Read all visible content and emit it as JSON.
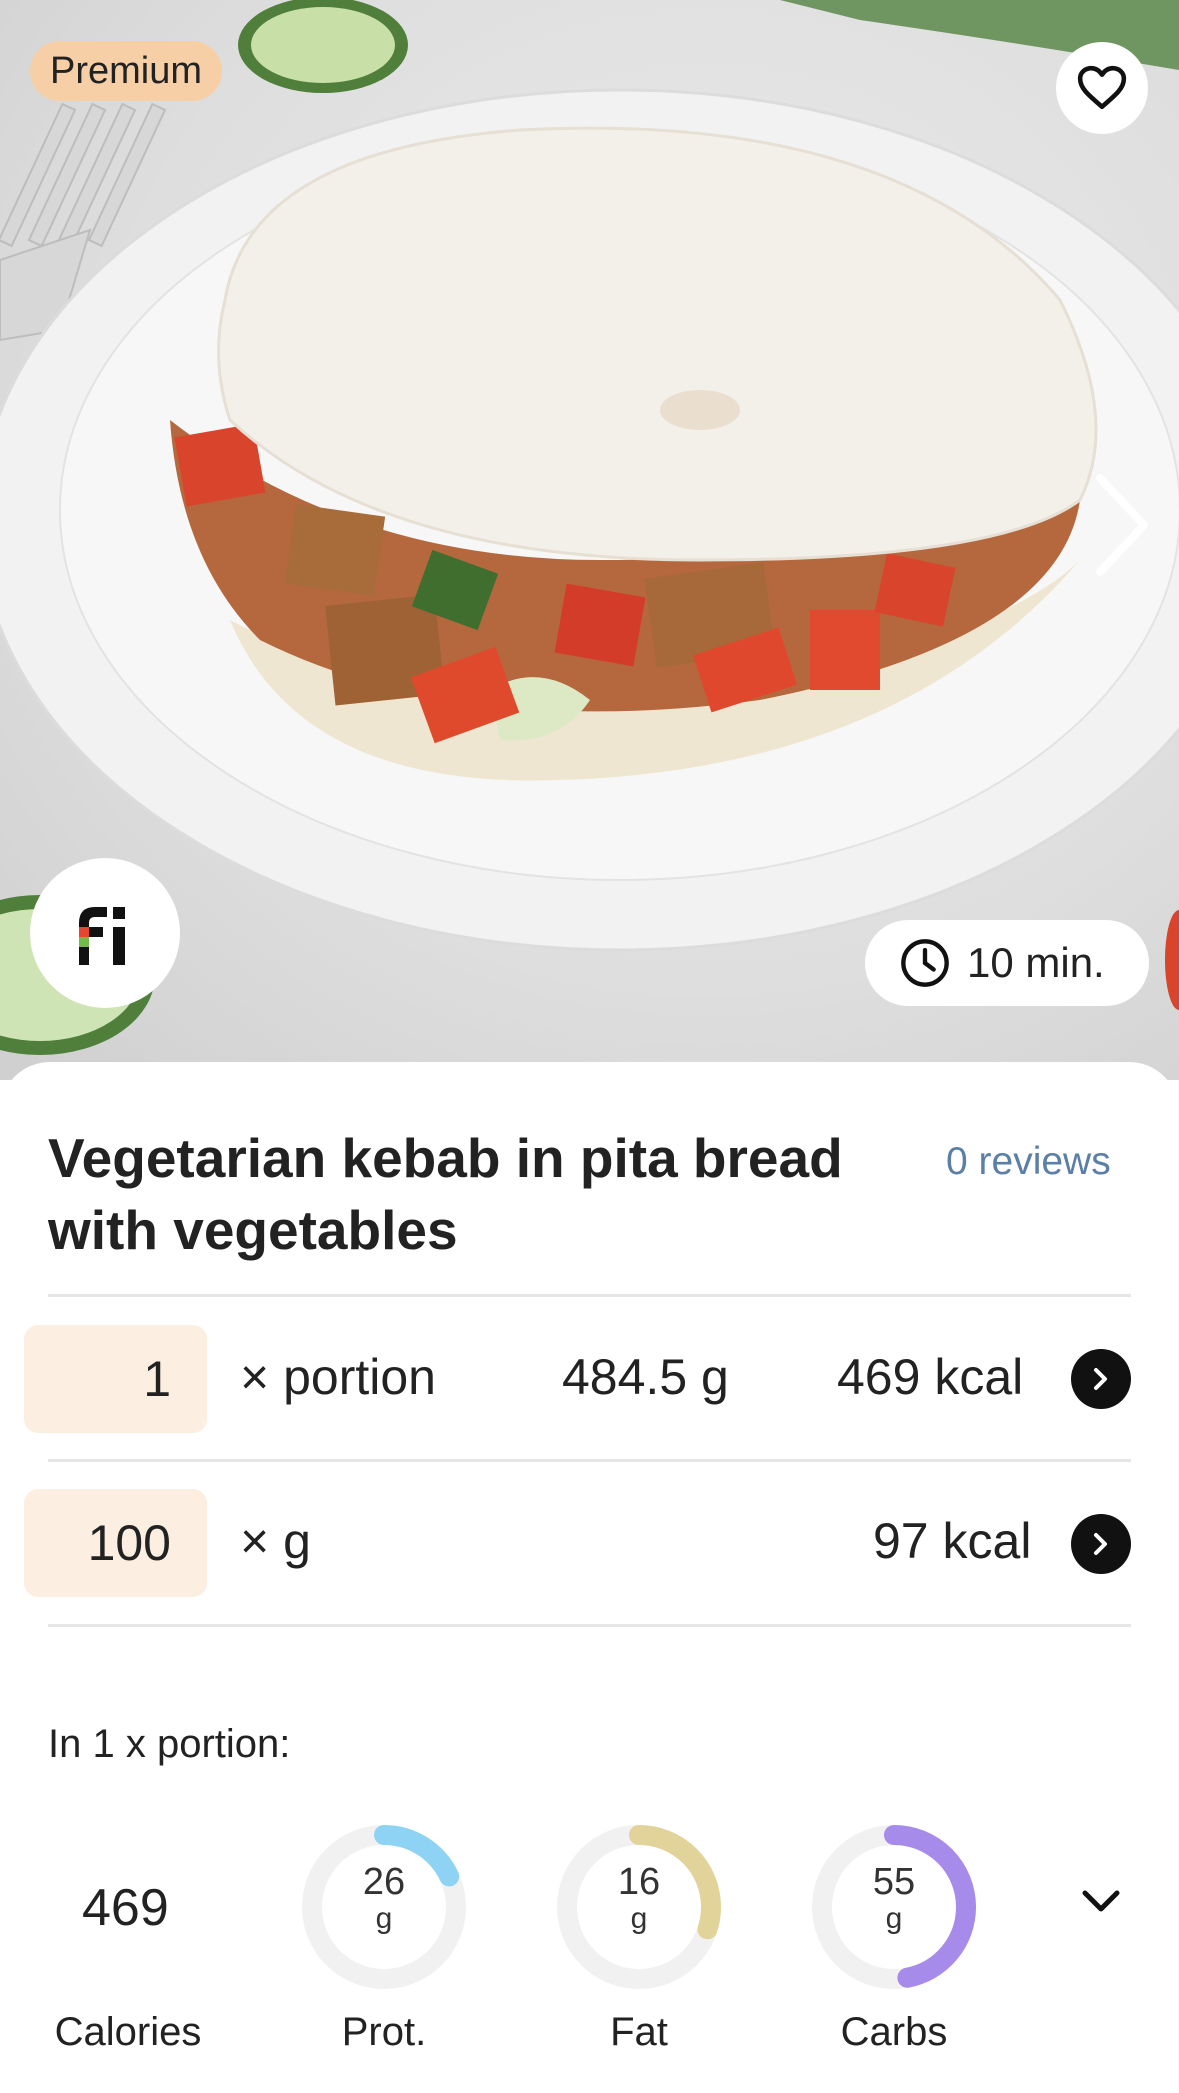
{
  "badge": {
    "label": "Premium"
  },
  "time": {
    "label": "10 min."
  },
  "recipe": {
    "title": "Vegetarian kebab in pita bread with vegetables",
    "reviews": "0 reviews"
  },
  "rows": [
    {
      "qty": "1",
      "unit": "× portion",
      "weight": "484.5 g",
      "kcal": "469 kcal"
    },
    {
      "qty": "100",
      "unit": "× g",
      "weight": "",
      "kcal": "97 kcal"
    }
  ],
  "nutrition": {
    "heading": "In 1 x portion:",
    "calories": {
      "value": "469",
      "label": "Calories"
    },
    "protein": {
      "value": "26",
      "unit": "g",
      "label": "Prot.",
      "fraction": 0.18,
      "color": "#8fd3f4"
    },
    "fat": {
      "value": "16",
      "unit": "g",
      "label": "Fat",
      "fraction": 0.3,
      "color": "#e2d39a"
    },
    "carbs": {
      "value": "55",
      "unit": "g",
      "label": "Carbs",
      "fraction": 0.47,
      "color": "#a78bea"
    }
  },
  "colors": {
    "accent_link": "#5b7fa6",
    "qty_bg": "#fcefe2",
    "premium_bg": "#f7cfa6"
  },
  "icons": [
    "heart-icon",
    "chevron-right-icon",
    "app-logo-icon",
    "clock-icon",
    "arrow-right-icon",
    "chevron-down-icon"
  ]
}
